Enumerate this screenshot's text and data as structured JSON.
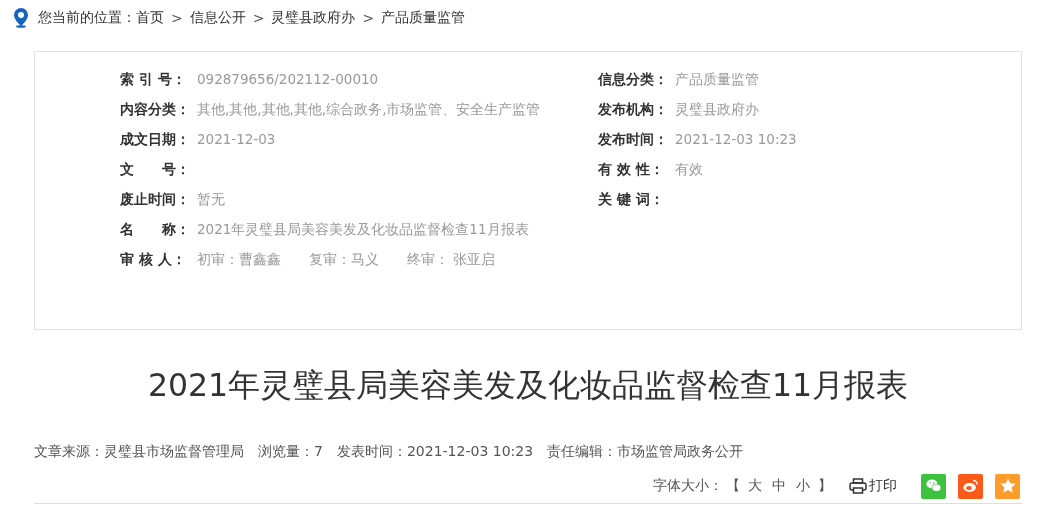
{
  "breadcrumb": {
    "prefix": "您当前的位置：",
    "items": [
      "首页",
      "信息公开",
      "灵璧县政府办",
      "产品质量监管"
    ],
    "separator": ">"
  },
  "info": {
    "rows": [
      {
        "left": {
          "label": "索 引 号：",
          "value": "092879656/202112-00010"
        },
        "right": {
          "label": "信息分类：",
          "value": "产品质量监管"
        }
      },
      {
        "left": {
          "label": "内容分类：",
          "value": "其他,其他,其他,其他,综合政务,市场监管、安全生产监管"
        },
        "right": {
          "label": "发布机构：",
          "value": "灵璧县政府办"
        }
      },
      {
        "left": {
          "label": "成文日期：",
          "value": "2021-12-03"
        },
        "right": {
          "label": "发布时间：",
          "value": "2021-12-03 10:23"
        }
      },
      {
        "left": {
          "label": "文　　号："
        },
        "right": {
          "label": "有 效 性：",
          "value": "有效"
        }
      },
      {
        "left": {
          "label": "废止时间：",
          "value": "暂无"
        },
        "right": {
          "label": "关 键 词："
        }
      },
      {
        "left": {
          "label": "名　　称：",
          "value": "2021年灵璧县局美容美发及化妆品监督检查11月报表"
        }
      },
      {
        "left": {
          "label": "审 核 人：",
          "value": "初审：曹鑫鑫　　复审：马义　　终审： 张亚启"
        }
      }
    ]
  },
  "title": "2021年灵璧县局美容美发及化妆品监督检查11月报表",
  "meta": [
    "文章来源：灵璧县市场监督管理局",
    "浏览量：7",
    "发表时间：2021-12-03 10:23",
    "责任编辑：市场监管局政务公开"
  ],
  "tools": {
    "font_size_label": "字体大小：",
    "bracket_open": "【",
    "sizes": [
      "大",
      "中",
      "小"
    ],
    "bracket_close": "】",
    "print": "打印",
    "share": [
      {
        "kind": "wechat",
        "color": "#3cc23c"
      },
      {
        "kind": "weibo",
        "color": "#fb5a1a"
      },
      {
        "kind": "qzone",
        "color": "#fd9b2b"
      }
    ]
  }
}
